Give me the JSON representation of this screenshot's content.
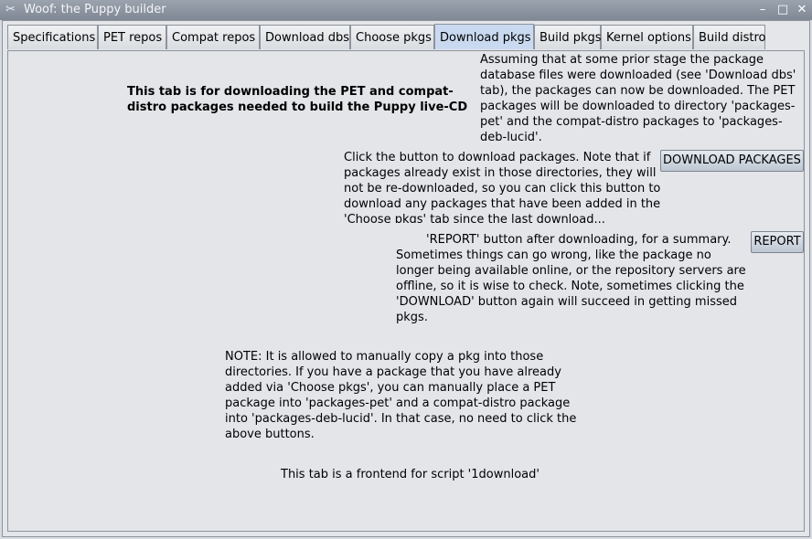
{
  "window": {
    "title": "Woof: the Puppy builder",
    "icon": "tools-icon",
    "controls": {
      "minimize": "–",
      "maximize": "□",
      "close": "✕"
    }
  },
  "tabs": [
    {
      "label": "Specifications",
      "active": false
    },
    {
      "label": "PET repos",
      "active": false
    },
    {
      "label": "Compat repos",
      "active": false
    },
    {
      "label": "Download dbs",
      "active": false
    },
    {
      "label": "Choose pkgs",
      "active": false
    },
    {
      "label": "Download pkgs",
      "active": true
    },
    {
      "label": "Build pkgs",
      "active": false
    },
    {
      "label": "Kernel options",
      "active": false
    },
    {
      "label": "Build distro",
      "active": false
    }
  ],
  "panel": {
    "heading": "This tab is for downloading the PET and compat-distro packages needed to build the Puppy live-CD",
    "intro": "Assuming that at some prior stage the package database files were downloaded (see 'Download dbs' tab), the packages can now be downloaded. The PET packages will be downloaded to directory 'packages-pet' and the compat-distro packages to 'packages-deb-lucid'.",
    "download_help": "Click the button to download packages. Note that if packages already exist in those directories, they will not be re-downloaded, so you can click this button to download any packages that have been added in the 'Choose pkgs' tab since the last download...",
    "download_button": "DOWNLOAD PACKAGES",
    "report_help": "'REPORT' button after downloading, for a summary. Sometimes things can go wrong, like the package no longer being available online, or the repository servers are offline, so it is wise to check. Note, sometimes clicking the 'DOWNLOAD' button again will succeed in getting missed pkgs.",
    "report_button": "REPORT",
    "note": "NOTE: It is allowed to manually copy a pkg into those directories. If you have a package that you have already added via 'Choose pkgs', you can manually place a PET package into 'packages-pet' and a compat-distro package into 'packages-deb-lucid'. In that case, no need to click the above buttons.",
    "footer": "This tab is a frontend for script '1download'"
  },
  "colors": {
    "active_tab": "#c9daf0",
    "titlebar": "#8a929d"
  }
}
